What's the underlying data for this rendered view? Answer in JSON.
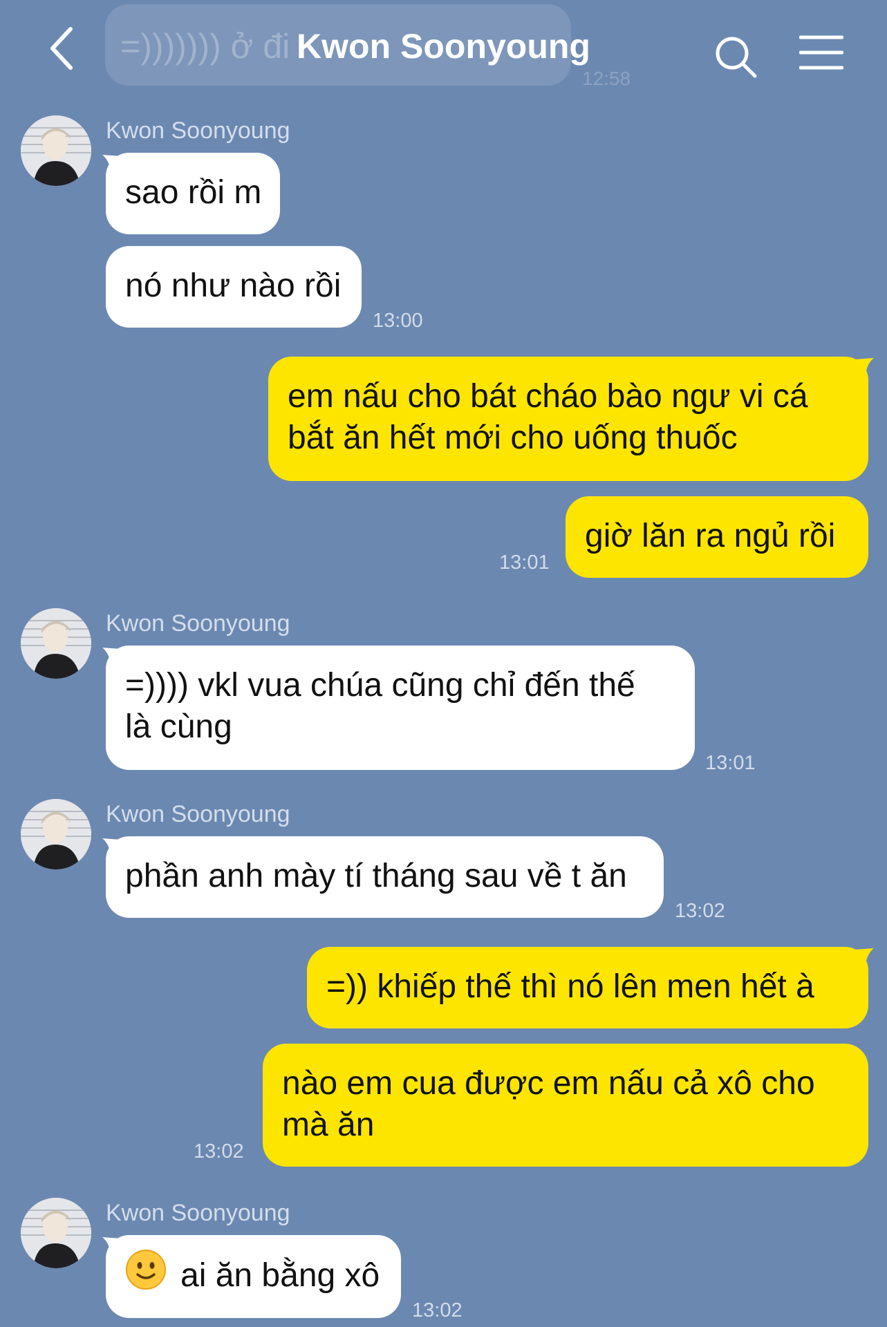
{
  "header": {
    "title": "Kwon Soonyoung",
    "back_icon": "chevron-left-icon",
    "search_icon": "search-icon",
    "menu_icon": "menu-icon",
    "ghost_message": "=))))))) ở đi ",
    "ghost_time": "12:58"
  },
  "messages": [
    {
      "side": "in",
      "sender": "Kwon Soonyoung",
      "lines": [
        "sao rồi m"
      ]
    },
    {
      "side": "in",
      "lines": [
        "nó như nào rồi"
      ],
      "time": "13:00"
    },
    {
      "side": "out",
      "lines": [
        "em nấu cho bát cháo bào ngư vi cá",
        "bắt ăn hết mới cho uống thuốc"
      ]
    },
    {
      "side": "out",
      "lines": [
        "giờ lăn ra ngủ rồi"
      ],
      "time": "13:01"
    },
    {
      "side": "in",
      "sender": "Kwon Soonyoung",
      "lines": [
        "=)))) vkl vua chúa cũng chỉ đến thế",
        "là cùng"
      ],
      "time": "13:01"
    },
    {
      "side": "in",
      "sender": "Kwon Soonyoung",
      "lines": [
        "phần anh mày tí tháng sau về t ăn"
      ],
      "time": "13:02"
    },
    {
      "side": "out",
      "lines": [
        "=)) khiếp thế thì nó lên men hết à"
      ]
    },
    {
      "side": "out",
      "lines": [
        "nào em cua được em nấu cả xô cho",
        "mà ăn"
      ],
      "time": "13:02"
    },
    {
      "side": "in",
      "sender": "Kwon Soonyoung",
      "emoji": "smiling-face-icon",
      "lines": [
        "ai ăn bằng xô"
      ],
      "time": "13:02"
    }
  ],
  "colors": {
    "background": "#6b88b1",
    "incoming_bubble": "#ffffff",
    "outgoing_bubble": "#fee500"
  }
}
